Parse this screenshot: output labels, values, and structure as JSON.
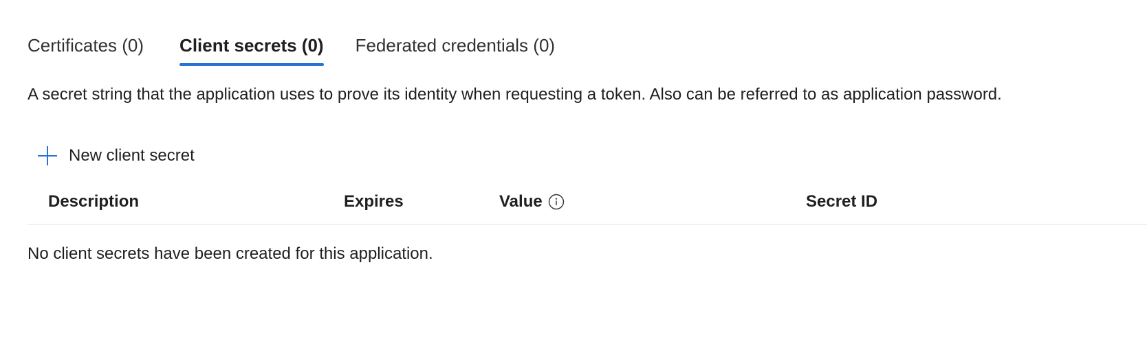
{
  "tabs": [
    {
      "label": "Certificates (0)",
      "selected": false
    },
    {
      "label": "Client secrets (0)",
      "selected": true
    },
    {
      "label": "Federated credentials (0)",
      "selected": false
    }
  ],
  "description": "A secret string that the application uses to prove its identity when requesting a token. Also can be referred to as application password.",
  "toolbar": {
    "new_secret_label": "New client secret",
    "new_secret_icon": "plus-icon"
  },
  "table": {
    "columns": {
      "description": "Description",
      "expires": "Expires",
      "value": "Value",
      "secret_id": "Secret ID"
    },
    "value_info_icon": "info-icon",
    "empty_message": "No client secrets have been created for this application."
  },
  "colors": {
    "accent": "#2b72d6",
    "text": "#1f1f1f",
    "divider": "#e1dfdd"
  }
}
